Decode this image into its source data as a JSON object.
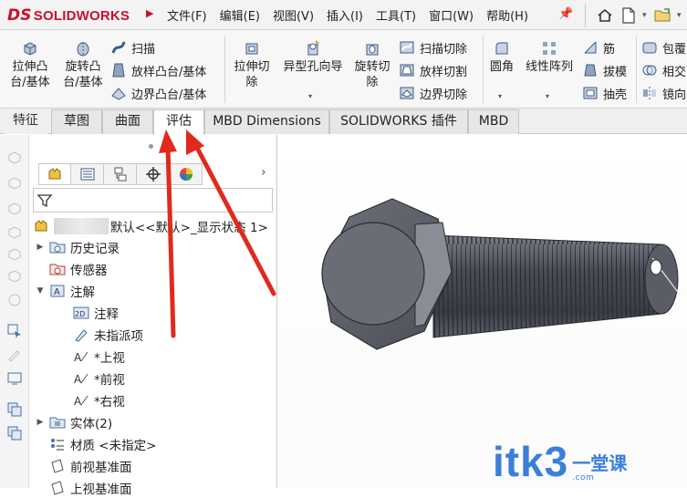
{
  "app": {
    "logo_prefix": "DS",
    "logo_text": "SOLIDWORKS"
  },
  "menu": [
    {
      "label": "文件(F)"
    },
    {
      "label": "编辑(E)"
    },
    {
      "label": "视图(V)"
    },
    {
      "label": "插入(I)"
    },
    {
      "label": "工具(T)"
    },
    {
      "label": "窗口(W)"
    },
    {
      "label": "帮助(H)"
    }
  ],
  "ribbon": {
    "extrude_boss": "拉伸凸\n台/基体",
    "revolve_boss": "旋转凸\n台/基体",
    "sweep": "扫描",
    "loft_boss": "放样凸台/基体",
    "boundary_boss": "边界凸台/基体",
    "extrude_cut": "拉伸切\n除",
    "hole_wizard": "异型孔向导",
    "revolve_cut": "旋转切\n除",
    "swept_cut": "扫描切除",
    "lofted_cut": "放样切割",
    "boundary_cut": "边界切除",
    "fillet": "圆角",
    "linear_pattern": "线性阵列",
    "rib": "筋",
    "draft": "拔模",
    "shell": "抽壳",
    "wrap": "包覆",
    "intersect": "相交",
    "mirror": "镜向"
  },
  "tabs": [
    {
      "label": "特征"
    },
    {
      "label": "草图"
    },
    {
      "label": "曲面"
    },
    {
      "label": "评估"
    },
    {
      "label": "MBD Dimensions"
    },
    {
      "label": "SOLIDWORKS 插件"
    },
    {
      "label": "MBD"
    }
  ],
  "tree": {
    "root_label": "默认<<默认>_显示状态 1>",
    "items": [
      {
        "label": "历史记录"
      },
      {
        "label": "传感器"
      },
      {
        "label": "注解"
      },
      {
        "label": "注释"
      },
      {
        "label": "未指派项"
      },
      {
        "label": "*上视"
      },
      {
        "label": "*前视"
      },
      {
        "label": "*右视"
      },
      {
        "label": "实体(2)"
      },
      {
        "label": "材质 <未指定>"
      },
      {
        "label": "前视基准面"
      },
      {
        "label": "上视基准面"
      }
    ]
  },
  "watermark": {
    "text": "itk3",
    "cn": "一堂课",
    "domain": ".com"
  },
  "colors": {
    "brand_red": "#c8102e",
    "arrow_red": "#e02a1e",
    "watermark_blue": "#3b7fd8",
    "bolt_dark": "#5a5d66"
  }
}
